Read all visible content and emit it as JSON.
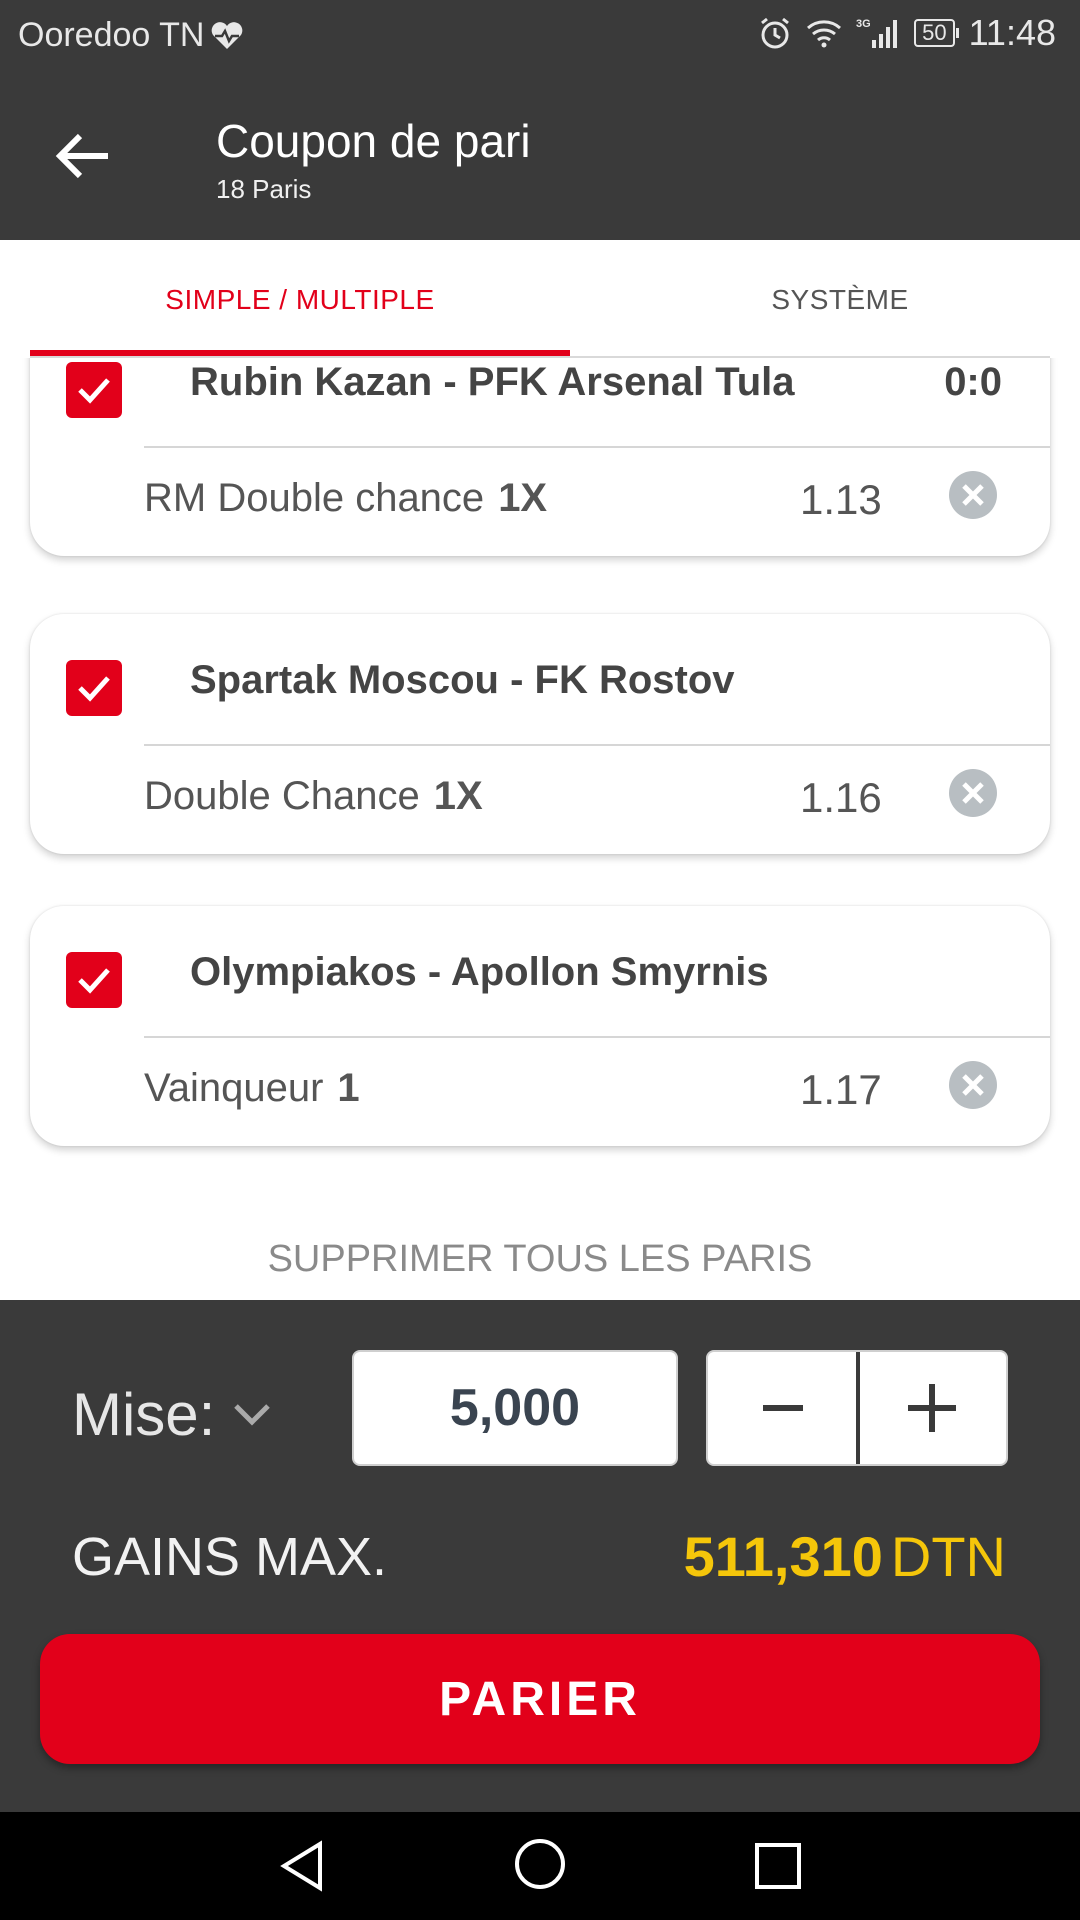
{
  "status_bar": {
    "carrier": "Ooredoo TN",
    "network": "3G",
    "battery": "50",
    "time": "11:48"
  },
  "toolbar": {
    "title": "Coupon de pari",
    "subtitle": "18 Paris"
  },
  "tabs": [
    {
      "label": "SIMPLE / MULTIPLE",
      "active": true
    },
    {
      "label": "SYSTÈME",
      "active": false
    }
  ],
  "bets": [
    {
      "match": "Rubin Kazan - PFK Arsenal Tula",
      "score": "0:0",
      "market": "RM Double chance",
      "selection": "1X",
      "odds": "1.13",
      "checked": true
    },
    {
      "match": "Spartak Moscou - FK Rostov",
      "score": "",
      "market": "Double Chance",
      "selection": "1X",
      "odds": "1.16",
      "checked": true
    },
    {
      "match": "Olympiakos - Apollon Smyrnis",
      "score": "",
      "market": "Vainqueur",
      "selection": "1",
      "odds": "1.17",
      "checked": true
    }
  ],
  "clear_all_label": "SUPPRIMER TOUS LES PARIS",
  "stake": {
    "label": "Mise:",
    "value": "5,000",
    "minus_label": "−",
    "plus_label": "+"
  },
  "gains": {
    "label": "GAINS MAX.",
    "amount": "511,310",
    "currency": "DTN"
  },
  "parier_label": "PARIER",
  "colors": {
    "accent": "#e2001a",
    "dark_bg": "#3a3a3a",
    "gains": "#f5c60a"
  }
}
